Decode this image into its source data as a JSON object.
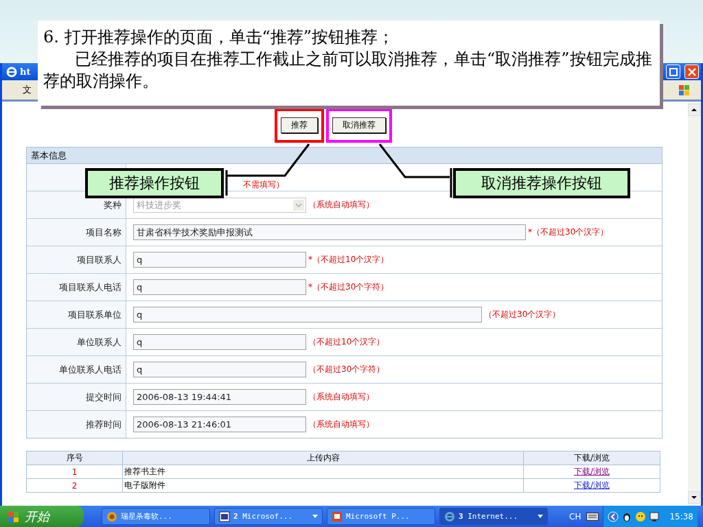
{
  "callout": {
    "paragraphs": [
      "6. 打开推荐操作的页面，单击“推荐”按钮推荐；",
      "已经推荐的项目在推荐工作截止之前可以取消推荐，单击“取消推荐”按钮完成推荐的取消操作。"
    ]
  },
  "browser": {
    "title": "ht",
    "menu": [
      "文"
    ]
  },
  "actions": [
    {
      "label": "推荐",
      "color": "#ff0000"
    },
    {
      "label": "取消推荐",
      "color": "#ff00ff"
    }
  ],
  "annotations": [
    {
      "label": "推荐操作按钮"
    },
    {
      "label": "取消推荐操作按钮"
    }
  ],
  "form": {
    "title": "基本信息",
    "note": "不需填写）",
    "rows": [
      {
        "label": "奖种",
        "kind": "select",
        "value": "科技进步奖",
        "disabled": true,
        "hint": "（系统自动填写）"
      },
      {
        "label": "项目名称",
        "kind": "text",
        "value": "甘肃省科学技术奖励申报测试",
        "hint": "*（不超过30个汉字）"
      },
      {
        "label": "项目联系人",
        "kind": "text",
        "value": "q",
        "hint": "*（不超过10个汉字）"
      },
      {
        "label": "项目联系人电话",
        "kind": "text",
        "value": "q",
        "hint": "*（不超过30个字符）"
      },
      {
        "label": "项目联系单位",
        "kind": "text",
        "value": "q",
        "hint": "（不超过30个汉字）"
      },
      {
        "label": "单位联系人",
        "kind": "text",
        "value": "q",
        "hint": "（不超过10个汉字）"
      },
      {
        "label": "单位联系人电话",
        "kind": "text",
        "value": "q",
        "hint": "（不超过30个字符）"
      },
      {
        "label": "提交时间",
        "kind": "text",
        "value": "2006-08-13 19:44:41",
        "hint": "（系统自动填写）"
      },
      {
        "label": "推荐时间",
        "kind": "text",
        "value": "2006-08-13 21:46:01",
        "hint": "（系统自动填写）"
      }
    ]
  },
  "uploads": {
    "columns": [
      "序号",
      "上传内容",
      "下载/浏览"
    ],
    "rows": [
      {
        "index": "1",
        "name": "推荐书主件",
        "link": "下载/浏览",
        "visited": true
      },
      {
        "index": "2",
        "name": "电子版附件",
        "link": "下载/浏览",
        "visited": false
      }
    ]
  },
  "taskbar": {
    "start": "开始",
    "tasks": [
      {
        "label": "瑞星杀毒软...",
        "kind": "shield",
        "grouped": false,
        "selected": false
      },
      {
        "label": "**2** Microsof...",
        "kind": "word",
        "grouped": true,
        "selected": false
      },
      {
        "label": "Microsoft P...",
        "kind": "slides",
        "grouped": false,
        "selected": false
      },
      {
        "label": "**3** Internet...",
        "kind": "browser",
        "grouped": true,
        "selected": true
      }
    ],
    "language": "CH",
    "clock": "15:38"
  }
}
